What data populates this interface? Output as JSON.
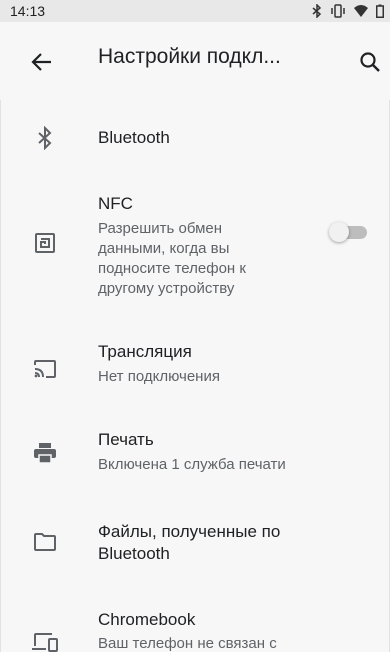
{
  "status_bar": {
    "time": "14:13",
    "icons": [
      "bluetooth-icon",
      "vibrate-icon",
      "wifi-icon",
      "battery-icon"
    ]
  },
  "app_bar": {
    "title": "Настройки подкл...",
    "back_icon": "arrow-back-icon",
    "search_icon": "search-icon"
  },
  "items": [
    {
      "icon": "bluetooth-icon",
      "title": "Bluetooth"
    },
    {
      "icon": "nfc-icon",
      "title": "NFC",
      "summary": [
        "Разрешить обмен",
        "данными, когда вы",
        "подносите телефон к",
        "другому устройству"
      ],
      "toggle": {
        "checked": false
      }
    },
    {
      "icon": "cast-icon",
      "title": "Трансляция",
      "summary": "Нет подключения"
    },
    {
      "icon": "print-icon",
      "title": "Печать",
      "summary": "Включена 1 служба печати"
    },
    {
      "icon": "folder-icon",
      "title": [
        "Файлы, полученные по",
        "Bluetooth"
      ]
    },
    {
      "icon": "devices-icon",
      "title": "Chromebook",
      "summary": "Ваш телефон не связан с"
    }
  ]
}
